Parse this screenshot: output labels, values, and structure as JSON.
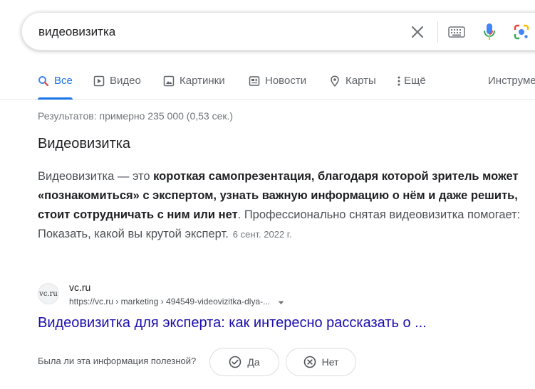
{
  "search": {
    "query": "видеовизитка"
  },
  "tabs": [
    {
      "label": "Все",
      "icon": "search-icon",
      "active": true
    },
    {
      "label": "Видео",
      "icon": "play-icon"
    },
    {
      "label": "Картинки",
      "icon": "image-icon"
    },
    {
      "label": "Новости",
      "icon": "news-icon"
    },
    {
      "label": "Карты",
      "icon": "map-pin-icon"
    },
    {
      "label": "Ещё",
      "icon": "more-vert-icon"
    },
    {
      "label": "Инструменты"
    }
  ],
  "result_stats": "Результатов: примерно 235 000 (0,53 сек.)",
  "featured_snippet": {
    "title": "Видеовизитка",
    "text_plain_1": "Видеовизитка — это ",
    "text_bold": "короткая самопрезентация, благодаря которой зритель может «познакомиться» с экспертом, узнать важную информацию о нём и даже решить, стоит сотрудничать с ним или нет",
    "text_plain_2": ". Профессионально снятая видеовизитка помогает: Показать, какой вы крутой эксперт.",
    "date": "6 сент. 2022 г."
  },
  "source": {
    "favicon_text": "vc.ru",
    "site_name": "vc.ru",
    "url": "https://vc.ru › marketing › 494549-videovizitka-dlya-...",
    "link_title": "Видеовизитка для эксперта: как интересно рассказать о ..."
  },
  "feedback": {
    "question": "Была ли эта информация полезной?",
    "yes_label": "Да",
    "no_label": "Нет"
  },
  "colors": {
    "accent": "#1a73e8",
    "link": "#1a0dab",
    "muted": "#70757a"
  }
}
